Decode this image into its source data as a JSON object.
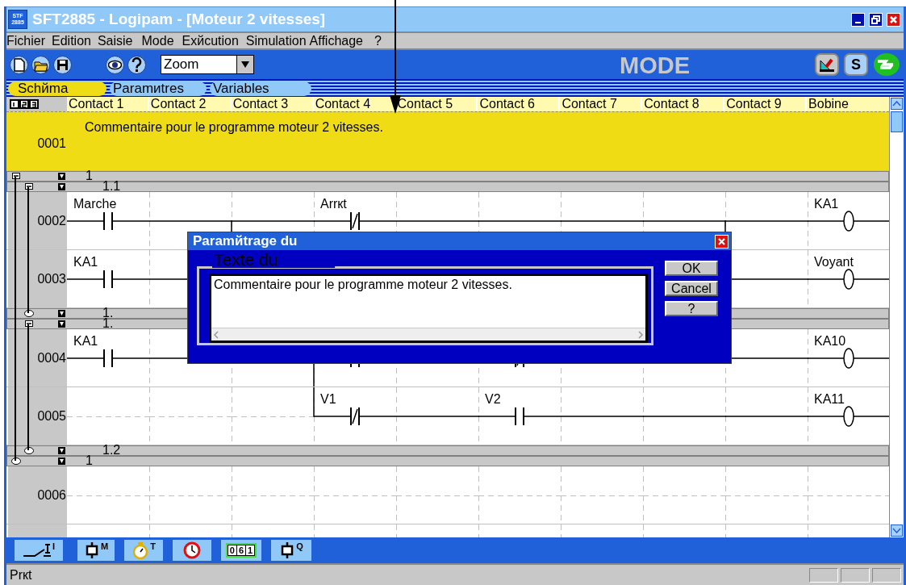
{
  "window": {
    "title": "SFT2885 - Logipam - [Moteur 2 vitesses]",
    "app_icon": [
      "STF",
      "2885"
    ]
  },
  "menu": [
    "Fichier",
    "Edition",
    "Saisie",
    "Mode",
    "Exйcution",
    "Simulation",
    "Affichage",
    "?"
  ],
  "toolbar": {
    "zoom": "Zoom",
    "mode": "MODE",
    "s_button": "S"
  },
  "tabs": [
    {
      "label": "Schйma",
      "selected": true
    },
    {
      "label": "Paramиtres",
      "selected": false
    },
    {
      "label": "Variables",
      "selected": false
    }
  ],
  "columns": [
    "Contact 1",
    "Contact 2",
    "Contact 3",
    "Contact 4",
    "Contact 5",
    "Contact 6",
    "Contact 7",
    "Contact 8",
    "Contact 9",
    "Bobine"
  ],
  "rows": [
    {
      "kind": "comment",
      "number": "0001",
      "text": "Commentaire pour le programme moteur 2 vitesses."
    },
    {
      "kind": "group",
      "label": "1",
      "end_label": "1",
      "expanded": true,
      "children": [
        {
          "kind": "group",
          "label": "1.1",
          "end_label": "1.",
          "expanded": true,
          "children": [
            {
              "kind": "rung",
              "number": "0002",
              "cells": [
                {
                  "kind": "contact_no",
                  "label": "Marche"
                },
                {
                  "kind": "wire",
                  "link_down": true
                },
                {
                  "kind": "wire"
                },
                {
                  "kind": "contact_nc",
                  "label": "Arrкt"
                },
                {
                  "kind": "wire"
                },
                {
                  "kind": "wire"
                },
                {
                  "kind": "wire"
                },
                {
                  "kind": "wire",
                  "link_down": true
                },
                {
                  "kind": "wire"
                },
                {
                  "kind": "coil",
                  "label": "KA1"
                }
              ]
            },
            {
              "kind": "rung",
              "number": "0003",
              "cells": [
                {
                  "kind": "contact_no",
                  "label": "KA1"
                },
                {
                  "kind": "wire"
                },
                {
                  "kind": "empty"
                },
                {
                  "kind": "empty"
                },
                {
                  "kind": "empty"
                },
                {
                  "kind": "empty"
                },
                {
                  "kind": "empty"
                },
                {
                  "kind": "empty"
                },
                {
                  "kind": "wire"
                },
                {
                  "kind": "coil",
                  "label": "Voyant"
                }
              ]
            }
          ]
        },
        {
          "kind": "group",
          "label": "1.",
          "end_label": "1.2",
          "expanded": true,
          "children": [
            {
              "kind": "rung",
              "number": "0004",
              "cells": [
                {
                  "kind": "contact_no",
                  "label": "KA1"
                },
                {
                  "kind": "wire"
                },
                {
                  "kind": "wire",
                  "link_down": true
                },
                {
                  "kind": "contact_no"
                },
                {
                  "kind": "wire"
                },
                {
                  "kind": "contact_nc"
                },
                {
                  "kind": "wire"
                },
                {
                  "kind": "wire"
                },
                {
                  "kind": "wire"
                },
                {
                  "kind": "coil",
                  "label": "KA10"
                }
              ]
            },
            {
              "kind": "rung",
              "number": "0005",
              "cells": [
                {
                  "kind": "empty"
                },
                {
                  "kind": "empty"
                },
                {
                  "kind": "empty"
                },
                {
                  "kind": "contact_nc",
                  "label": "V1"
                },
                {
                  "kind": "wire"
                },
                {
                  "kind": "contact_no",
                  "label": "V2"
                },
                {
                  "kind": "wire"
                },
                {
                  "kind": "wire"
                },
                {
                  "kind": "wire"
                },
                {
                  "kind": "coil",
                  "label": "KA11"
                }
              ]
            }
          ]
        }
      ]
    },
    {
      "kind": "rung",
      "number": "0006",
      "cells": [
        {
          "kind": "empty"
        },
        {
          "kind": "empty"
        },
        {
          "kind": "empty"
        },
        {
          "kind": "empty"
        },
        {
          "kind": "empty"
        },
        {
          "kind": "empty"
        },
        {
          "kind": "empty"
        },
        {
          "kind": "empty"
        },
        {
          "kind": "empty"
        },
        {
          "kind": "empty"
        }
      ]
    },
    {
      "kind": "rung",
      "cells": [
        {
          "kind": "empty"
        },
        {
          "kind": "empty"
        },
        {
          "kind": "empty"
        },
        {
          "kind": "empty"
        },
        {
          "kind": "empty"
        },
        {
          "kind": "empty"
        },
        {
          "kind": "empty"
        },
        {
          "kind": "empty"
        },
        {
          "kind": "empty"
        },
        {
          "kind": "empty"
        }
      ]
    }
  ],
  "dialog": {
    "title": "Paramйtrage du",
    "group_label": "Texte du",
    "text": "Commentaire pour le programme moteur 2 vitesses.",
    "buttons": [
      "OK",
      "Cancel",
      "?"
    ]
  },
  "palette": [
    {
      "kind": "contact",
      "letter": "I"
    },
    {
      "kind": "relay",
      "letter": "M"
    },
    {
      "kind": "timer",
      "letter": "T"
    },
    {
      "kind": "clock"
    },
    {
      "kind": "counter",
      "digits": [
        "0",
        "6",
        "1"
      ]
    },
    {
      "kind": "relay",
      "letter": "Q"
    }
  ],
  "status_bar": {
    "text": "Prкt"
  }
}
